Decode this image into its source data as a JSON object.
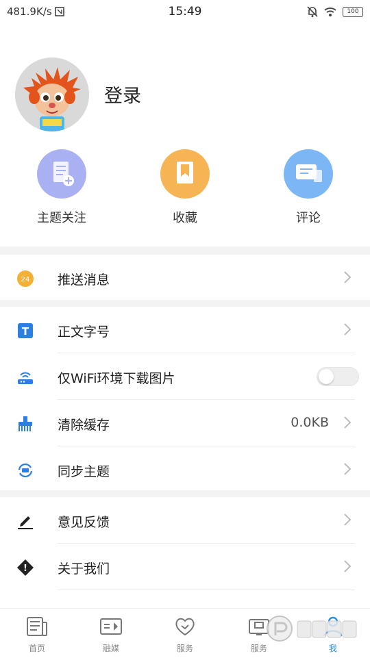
{
  "status": {
    "speed": "481.9K/s",
    "time": "15:49",
    "battery": "100"
  },
  "profile": {
    "login": "登录"
  },
  "quick_actions": [
    {
      "label": "主题关注",
      "icon": "doc-add-icon",
      "color": "#a9b1f2"
    },
    {
      "label": "收藏",
      "icon": "bookmark-icon",
      "color": "#f6b455"
    },
    {
      "label": "评论",
      "icon": "chat-icon",
      "color": "#7db6f5"
    }
  ],
  "menu": {
    "push": {
      "label": "推送消息",
      "icon": "push-badge-icon",
      "badge": "24"
    },
    "font": {
      "label": "正文字号",
      "icon": "font-size-icon",
      "glyph": "T"
    },
    "wifi": {
      "label": "仅WiFi环境下载图片",
      "icon": "router-icon",
      "toggle": false
    },
    "cache": {
      "label": "清除缓存",
      "icon": "cleaner-icon",
      "value": "0.0KB"
    },
    "sync": {
      "label": "同步主题",
      "icon": "sync-icon"
    },
    "feedback": {
      "label": "意见反馈",
      "icon": "pen-icon"
    },
    "about": {
      "label": "关于我们",
      "icon": "info-diamond-icon",
      "glyph": "!"
    }
  },
  "tabs": [
    {
      "label": "首页",
      "icon": "news-icon",
      "active": false
    },
    {
      "label": "融媒",
      "icon": "media-icon",
      "active": false
    },
    {
      "label": "服务",
      "icon": "heart-icon",
      "active": false
    },
    {
      "label": "服务",
      "icon": "tv-icon",
      "active": false
    },
    {
      "label": "我",
      "icon": "person-icon",
      "active": true
    }
  ],
  "colors": {
    "accent": "#2c8fe6",
    "badge": "#f2b134"
  }
}
